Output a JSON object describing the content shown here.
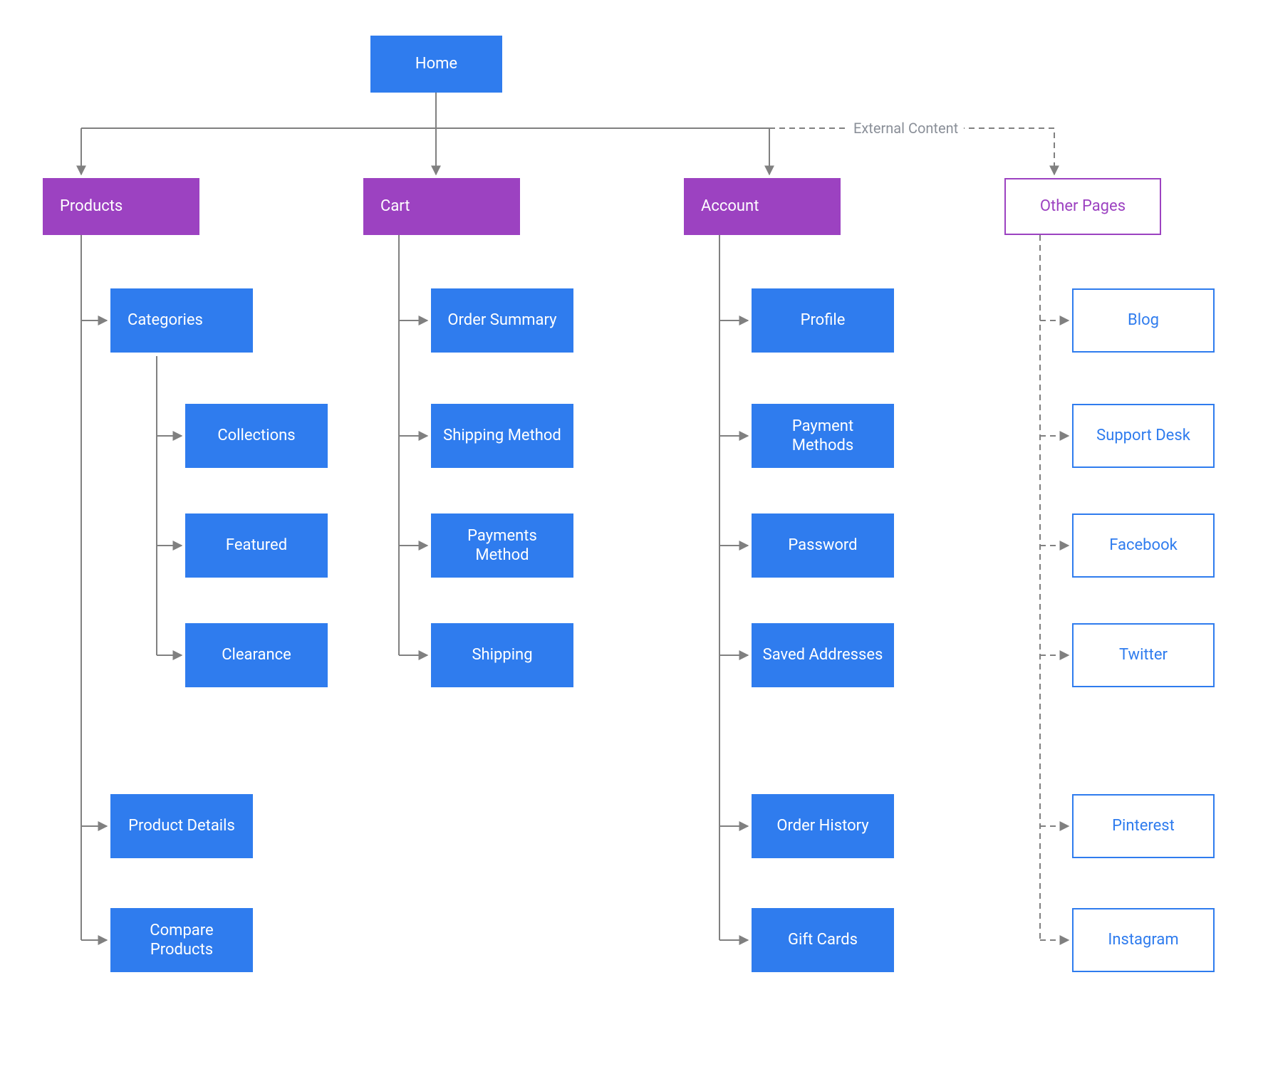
{
  "root": {
    "label": "Home"
  },
  "sections": {
    "products": {
      "label": "Products",
      "children": {
        "categories": {
          "label": "Categories",
          "children": [
            {
              "label": "Collections"
            },
            {
              "label": "Featured"
            },
            {
              "label": "Clearance"
            }
          ]
        },
        "details": {
          "label": "Product Details"
        },
        "compare": {
          "label": "Compare Products"
        }
      }
    },
    "cart": {
      "label": "Cart",
      "children": [
        {
          "label": "Order Summary"
        },
        {
          "label": "Shipping Method"
        },
        {
          "label": "Payments Method"
        },
        {
          "label": "Shipping"
        }
      ]
    },
    "account": {
      "label": "Account",
      "children": [
        {
          "label": "Profile"
        },
        {
          "label": "Payment Methods"
        },
        {
          "label": "Password"
        },
        {
          "label": "Saved Addresses"
        },
        {
          "label": "Order History"
        },
        {
          "label": "Gift Cards"
        }
      ]
    },
    "other": {
      "label": "Other Pages",
      "edge_label": "External Content",
      "children": [
        {
          "label": "Blog"
        },
        {
          "label": "Support Desk"
        },
        {
          "label": "Facebook"
        },
        {
          "label": "Twitter"
        },
        {
          "label": "Pinterest"
        },
        {
          "label": "Instagram"
        }
      ]
    }
  },
  "colors": {
    "blue": "#2F7CEE",
    "purple": "#9C42C1",
    "connector": "#808080",
    "dashed": "#808080",
    "label_gray": "#8a8f98"
  }
}
